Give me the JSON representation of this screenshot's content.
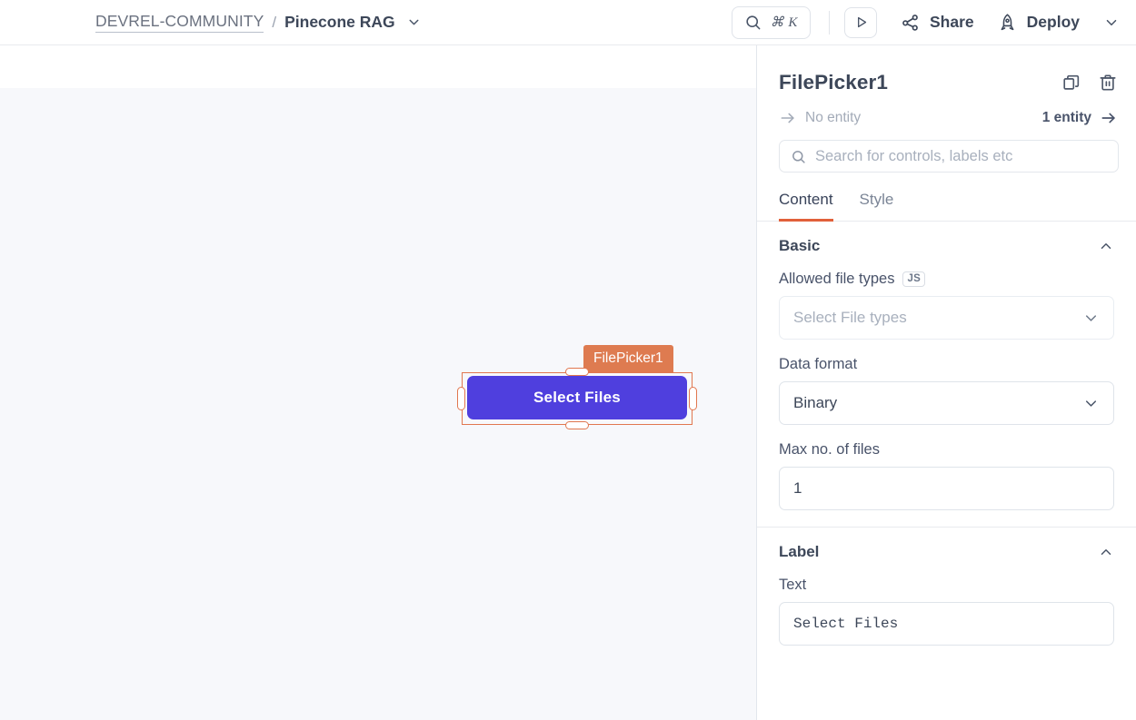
{
  "topbar": {
    "breadcrumb": {
      "org": "DEVREL-COMMUNITY",
      "separator": "/",
      "app": "Pinecone RAG",
      "chevron_icon": "chevron-down-icon"
    },
    "search": {
      "icon": "search-icon",
      "shortcut": "⌘ K"
    },
    "play": {
      "icon": "play-icon"
    },
    "share": {
      "icon": "share-icon",
      "label": "Share"
    },
    "deploy": {
      "icon": "rocket-icon",
      "label": "Deploy"
    },
    "more": {
      "icon": "chevron-down-icon"
    }
  },
  "canvas": {
    "widget": {
      "name_tab": "FilePicker1",
      "button_label": "Select Files",
      "button_color": "#4f3fde",
      "selection_color": "#e1774f",
      "tab_color": "#de7b50"
    }
  },
  "panel": {
    "title": "FilePicker1",
    "actions": [
      {
        "name": "copy-icon",
        "label": "Copy"
      },
      {
        "name": "trash-icon",
        "label": "Delete"
      }
    ],
    "entity_nav": {
      "prev_label": "No entity",
      "prev_icon": "arrow-right-icon",
      "next_label": "1 entity",
      "next_icon": "arrow-right-icon"
    },
    "search": {
      "icon": "search-icon",
      "placeholder": "Search for controls, labels etc",
      "value": ""
    },
    "tabs": [
      {
        "label": "Content",
        "active": true
      },
      {
        "label": "Style",
        "active": false
      }
    ],
    "accent_color": "#e1603a",
    "sections": [
      {
        "title": "Basic",
        "collapse_icon": "chevron-up-icon",
        "fields": [
          {
            "label": "Allowed file types",
            "badge": "JS",
            "type": "select",
            "value": "Select File types",
            "placeholder": true,
            "chevron_icon": "chevron-down-icon"
          },
          {
            "label": "Data format",
            "type": "select",
            "value": "Binary",
            "placeholder": false,
            "chevron_icon": "chevron-down-icon"
          },
          {
            "label": "Max no. of files",
            "type": "input",
            "value": "1",
            "placeholder": false
          }
        ]
      },
      {
        "title": "Label",
        "collapse_icon": "chevron-up-icon",
        "fields": [
          {
            "label": "Text",
            "type": "code-input",
            "value": "Select Files",
            "placeholder": false
          }
        ]
      }
    ]
  }
}
